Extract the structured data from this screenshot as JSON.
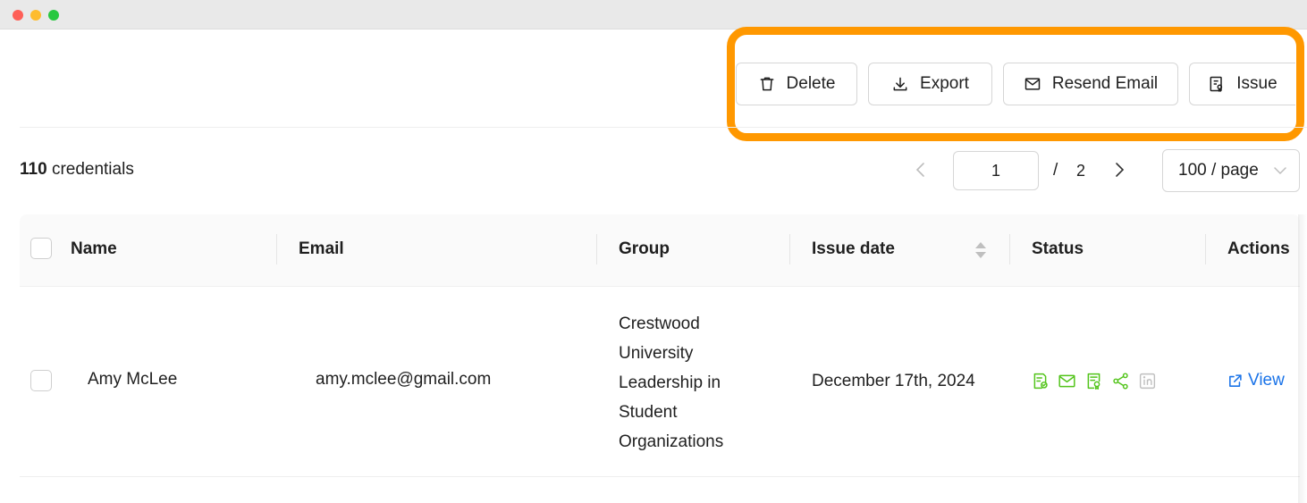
{
  "toolbar": {
    "delete_label": "Delete",
    "export_label": "Export",
    "resend_label": "Resend Email",
    "issue_label": "Issue"
  },
  "summary": {
    "count": "110",
    "count_suffix": "credentials"
  },
  "pagination": {
    "current_page": "1",
    "separator": "/",
    "total_pages": "2",
    "page_size": "100 / page"
  },
  "table": {
    "columns": [
      "Name",
      "Email",
      "Group",
      "Issue date",
      "Status",
      "Actions"
    ],
    "rows": [
      {
        "name": "Amy McLee",
        "email": "amy.mclee@gmail.com",
        "group": "Crestwood University Leadership in Student Organizations",
        "issue_date": "December 17th, 2024",
        "action_label": "View"
      }
    ]
  },
  "colors": {
    "highlight": "#ff9800",
    "status_active": "#52c41a",
    "status_inactive": "#bfbfbf",
    "link": "#1a73e8"
  },
  "icons": {
    "status": [
      "certificate-check-icon",
      "mail-icon",
      "badge-icon",
      "share-icon",
      "linkedin-icon"
    ]
  }
}
